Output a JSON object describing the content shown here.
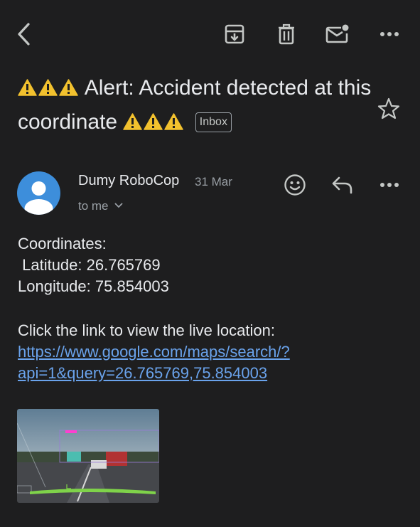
{
  "toolbar": {
    "back_icon": "back-arrow-icon",
    "archive_icon": "archive-icon",
    "delete_icon": "trash-icon",
    "mark_unread_icon": "mark-unread-icon",
    "more_icon": "more-horizontal-icon"
  },
  "subject": {
    "prefix_emoji": "⚠️⚠️⚠️",
    "text": "Alert: Accident detected at this coordinate",
    "suffix_emoji": "⚠️⚠️⚠️",
    "label": "Inbox"
  },
  "sender": {
    "name": "Dumy RoboCop",
    "date": "31 Mar",
    "recipient": "to me"
  },
  "message": {
    "line1": "Coordinates:",
    "line2": " Latitude: 26.765769",
    "line3": "Longitude: 75.854003",
    "line4": "Click the link to view the live location:",
    "link_line1": "https://www.google.com/maps/search/?",
    "link_line2": "api=1&query=26.765769,75.854003"
  },
  "attachment": {
    "icon": "image-thumbnail"
  },
  "colors": {
    "background": "#1e1e1f",
    "text": "#e8eaed",
    "muted": "#9aa0a6",
    "link": "#6aa3ec",
    "avatar": "#3d8edb",
    "warning": "#f2c12e"
  }
}
